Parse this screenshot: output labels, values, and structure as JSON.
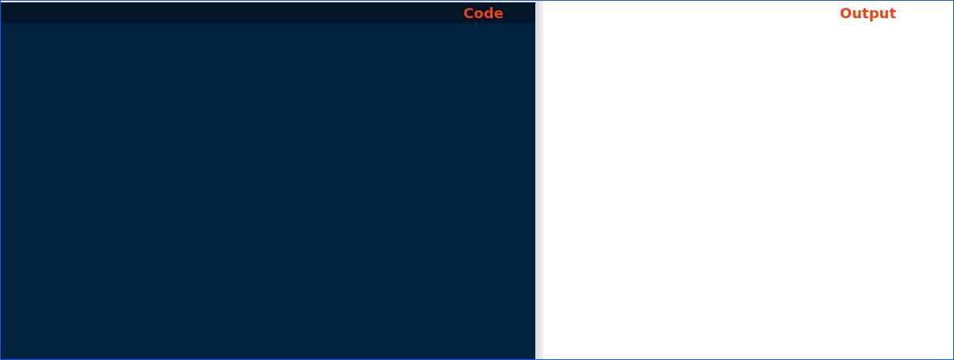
{
  "code_panel": {
    "label": "Code"
  },
  "output_panel": {
    "label": "Output"
  }
}
